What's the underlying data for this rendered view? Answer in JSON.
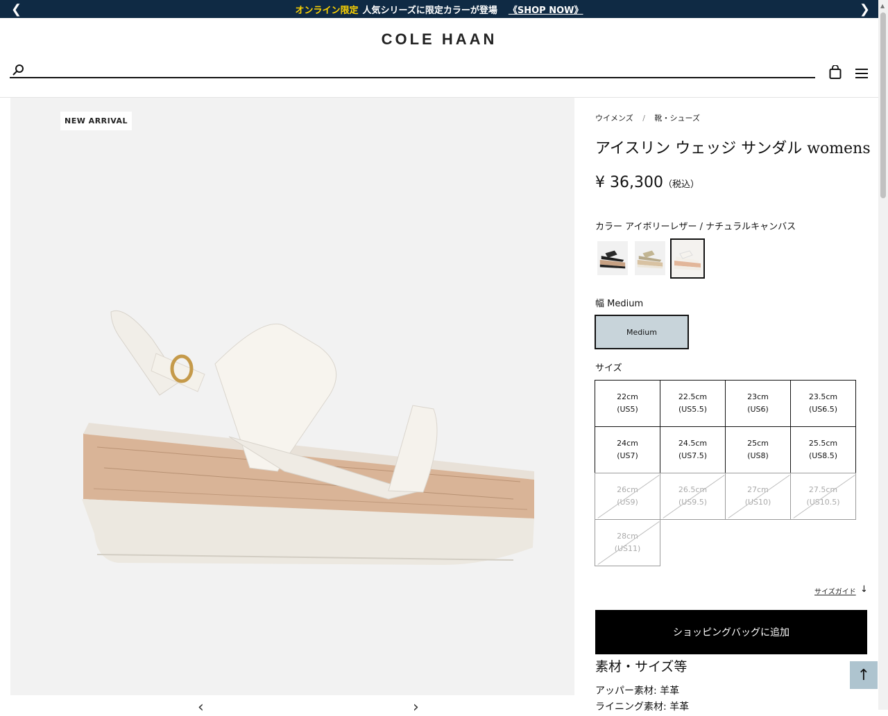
{
  "promo": {
    "highlight": "オンライン限定",
    "text": "人気シリーズに限定カラーが登場",
    "link": "《SHOP  NOW》"
  },
  "header": {
    "logo": "COLE HAAN"
  },
  "gallery": {
    "badge": "NEW ARRIVAL"
  },
  "breadcrumb": {
    "items": [
      "ウイメンズ",
      "靴・シューズ"
    ],
    "separator": "/"
  },
  "product": {
    "title": "アイスリン ウェッジ サンダル womens",
    "price": "¥ 36,300",
    "tax": "（税込）",
    "color_label": "カラー アイボリーレザー / ナチュラルキャンバス",
    "width_label": "幅 Medium",
    "width_option": "Medium",
    "size_label": "サイズ",
    "sizes": [
      {
        "cm": "22cm",
        "us": "(US5)",
        "available": true
      },
      {
        "cm": "22.5cm",
        "us": "(US5.5)",
        "available": true
      },
      {
        "cm": "23cm",
        "us": "(US6)",
        "available": true
      },
      {
        "cm": "23.5cm",
        "us": "(US6.5)",
        "available": true
      },
      {
        "cm": "24cm",
        "us": "(US7)",
        "available": true
      },
      {
        "cm": "24.5cm",
        "us": "(US7.5)",
        "available": true
      },
      {
        "cm": "25cm",
        "us": "(US8)",
        "available": true
      },
      {
        "cm": "25.5cm",
        "us": "(US8.5)",
        "available": true
      },
      {
        "cm": "26cm",
        "us": "(US9)",
        "available": false
      },
      {
        "cm": "26.5cm",
        "us": "(US9.5)",
        "available": false
      },
      {
        "cm": "27cm",
        "us": "(US10)",
        "available": false
      },
      {
        "cm": "27.5cm",
        "us": "(US10.5)",
        "available": false
      },
      {
        "cm": "28cm",
        "us": "(US11)",
        "available": false
      }
    ],
    "size_guide": "サイズガイド",
    "add_to_bag": "ショッピングバッグに追加"
  },
  "material": {
    "title": "素材・サイズ等",
    "rows": [
      "アッパー素材: 羊革",
      "ライニング素材: 羊革"
    ]
  },
  "colors": {
    "promo_bg": "#0f2a44",
    "promo_highlight": "#ffd400",
    "width_selected": "#c8d4da",
    "back_to_top": "#aec4cf"
  }
}
